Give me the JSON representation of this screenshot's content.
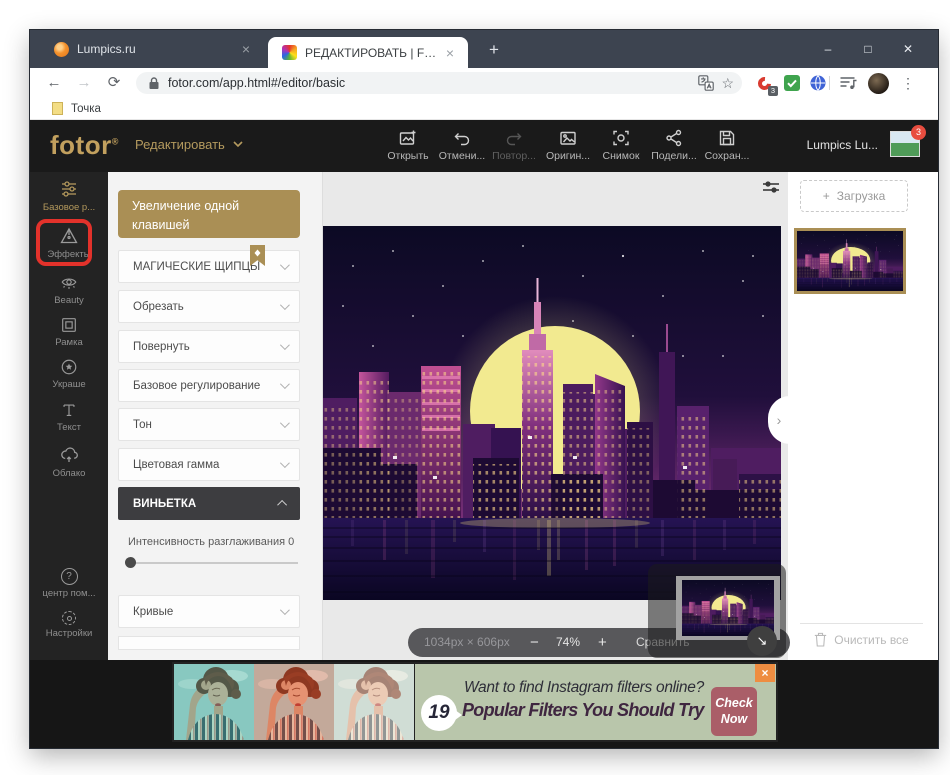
{
  "glyphs": {
    "close": "×",
    "win_minimize": "–",
    "win_maximize": "□",
    "win_close": "✕",
    "plus": "+",
    "minus": "−",
    "dots": "⋮",
    "back": "←",
    "forward": "→",
    "reload": "⟳",
    "star": "☆",
    "chevron_right": "›",
    "arrow_bottom_right": "↘",
    "question": "?"
  },
  "browser": {
    "tabs": [
      {
        "label": "Lumpics.ru"
      },
      {
        "label": "РЕДАКТИРОВАТЬ | Fotor"
      }
    ],
    "url": "fotor.com/app.html#/editor/basic",
    "extension_badge": "3",
    "bookmark": "Точка"
  },
  "header": {
    "logo": "fotor",
    "logo_reg": "®",
    "menu_label": "Редактировать",
    "tools": [
      {
        "label": "Открыть"
      },
      {
        "label": "Отмени..."
      },
      {
        "label": "Повтор..."
      },
      {
        "label": "Оригин..."
      },
      {
        "label": "Снимок"
      },
      {
        "label": "Подели..."
      },
      {
        "label": "Сохран..."
      }
    ],
    "account_name": "Lumpics Lu...",
    "account_badge": "3"
  },
  "sidebar": {
    "items": [
      {
        "label": "Базовое р..."
      },
      {
        "label": "Эффекты"
      },
      {
        "label": "Beauty"
      },
      {
        "label": "Рамка"
      },
      {
        "label": "Украше"
      },
      {
        "label": "Текст"
      },
      {
        "label": "Облако"
      }
    ],
    "bottom_items": [
      {
        "label": "центр пом..."
      },
      {
        "label": "Настройки"
      }
    ]
  },
  "panel": {
    "cta_label": "Увеличение одной клавишей",
    "sections": [
      {
        "label": "МАГИЧЕСКИЕ ЩИПЦЫ"
      },
      {
        "label": "Обрезать"
      },
      {
        "label": "Повернуть"
      },
      {
        "label": "Базовое регулирование"
      },
      {
        "label": "Тон"
      },
      {
        "label": "Цветовая гамма"
      },
      {
        "label": "ВИНЬЕТКА"
      },
      {
        "label": "Кривые"
      }
    ],
    "slider_label": "Интенсивность разглаживания",
    "slider_value": "0"
  },
  "canvas": {
    "dimensions": "1034px × 606px",
    "zoom_level": "74%",
    "compare_label": "Сравнить"
  },
  "uploads": {
    "add_label": "Загрузка",
    "clear_label": "Очистить все"
  },
  "ad": {
    "number": "19",
    "line1": "Want to find Instagram filters online?",
    "line2": "Popular Filters You Should Try",
    "cta_top": "Check",
    "cta_bottom": "Now"
  },
  "colors": {
    "gold": "#aa8f55",
    "highlight_red": "#e3322b",
    "header_bg": "#1a1a1a",
    "ad_green": "#b9c6ab",
    "ad_rose": "#aa5e68",
    "ad_orange": "#ee8d41"
  }
}
